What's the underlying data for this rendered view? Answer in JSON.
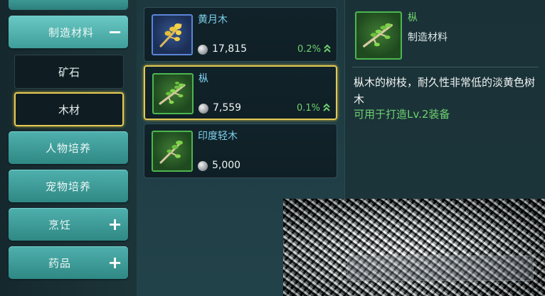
{
  "categories": {
    "main": [
      {
        "label": "制造材料",
        "sign": "−",
        "expanded": true
      },
      {
        "label": "人物培养"
      },
      {
        "label": "宠物培养"
      },
      {
        "label": "烹饪",
        "sign": "+"
      },
      {
        "label": "药品",
        "sign": "+"
      }
    ],
    "sub": [
      {
        "label": "矿石",
        "selected": false
      },
      {
        "label": "木材",
        "selected": true
      }
    ]
  },
  "items": [
    {
      "name": "黄月木",
      "price": "17,815",
      "change": "0.2%",
      "frame_color": "#5b86d6",
      "icon": "golden-branch-icon",
      "selected": false
    },
    {
      "name": "枞",
      "price": "7,559",
      "change": "0.1%",
      "frame_color": "#4db650",
      "icon": "leafy-branch-icon",
      "selected": true
    },
    {
      "name": "印度轻木",
      "price": "5,000",
      "change": "",
      "frame_color": "#4db650",
      "icon": "leafy-branch-icon",
      "selected": false
    }
  ],
  "detail": {
    "name": "枞",
    "type": "制造材料",
    "description": "枞木的树枝，耐久性非常低的淡黄色树木",
    "use": "可用于打造Lv.2装备"
  },
  "colors": {
    "accent_teal": "#3f9e99",
    "selected_gold": "#e3c955",
    "change_green": "#6fd06f",
    "name_blue": "#7fd2f0"
  }
}
